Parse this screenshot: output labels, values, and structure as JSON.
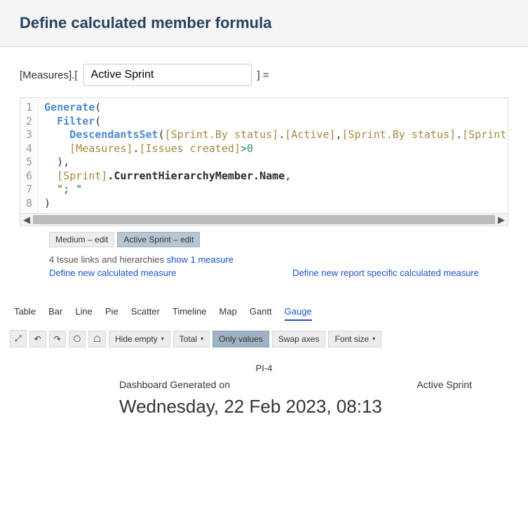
{
  "modal": {
    "title": "Define calculated member formula",
    "prefix": "[Measures].[",
    "member_name": "Active Sprint",
    "suffix": "]  ="
  },
  "editor": {
    "lines": [
      "1",
      "2",
      "3",
      "4",
      "5",
      "6",
      "7",
      "8"
    ],
    "code": {
      "l1_fn": "Generate",
      "l2_fn": "Filter",
      "l3_fn": "DescendantsSet",
      "l3_a1": "[Sprint.By status]",
      "l3_a2": "[Active]",
      "l3_a3": "[Sprint.By status]",
      "l3_a4": "[Sprint",
      "l4_a1": "[Measures]",
      "l4_a2": "[Issues created]",
      "l4_op": ">",
      "l4_num": "0",
      "l6_a1": "[Sprint]",
      "l6_m": ".CurrentHierarchyMember.Name",
      "l7_str": "\"; \""
    }
  },
  "tags": {
    "medium": "Medium – edit",
    "active": "Active Sprint – edit"
  },
  "links": {
    "issue_text": "4 Issue links and hierarchies ",
    "show_measure": "show 1 measure",
    "define_calc": "Define new calculated measure",
    "define_report": "Define new report specific calculated measure"
  },
  "tabs": {
    "table": "Table",
    "bar": "Bar",
    "line": "Line",
    "pie": "Pie",
    "scatter": "Scatter",
    "timeline": "Timeline",
    "map": "Map",
    "gantt": "Gantt",
    "gauge": "Gauge"
  },
  "toolbar": {
    "hide_empty": "Hide empty",
    "total": "Total",
    "only_values": "Only values",
    "swap_axes": "Swap axes",
    "font_size": "Font size"
  },
  "dashboard": {
    "pi": "PI-4",
    "gen_label": "Dashboard Generated on",
    "sprint_label": "Active Sprint",
    "date": "Wednesday, 22 Feb 2023, 08:13"
  }
}
